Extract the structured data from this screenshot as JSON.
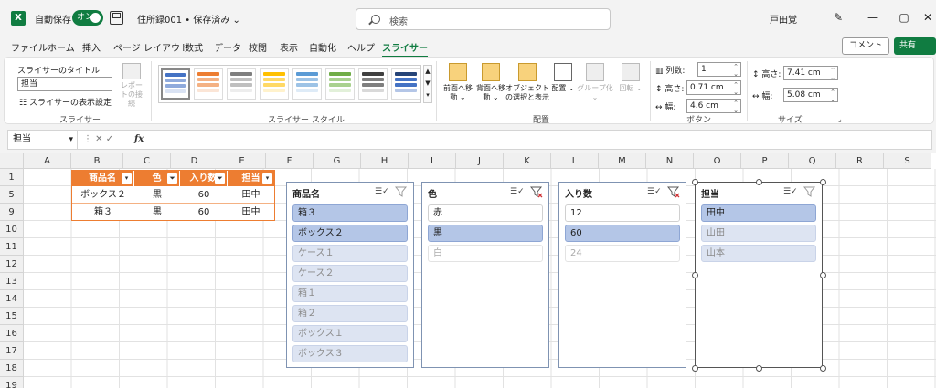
{
  "titlebar": {
    "logo": "X",
    "autosave_label": "自動保存",
    "autosave_state": "オン",
    "filename": "住所録001 • 保存済み ⌄",
    "search_placeholder": "検索",
    "username": "戸田覚",
    "minimize": "—",
    "maximize": "▢",
    "close": "✕"
  },
  "tabs": [
    "ファイル",
    "ホーム",
    "挿入",
    "ページ レイアウト",
    "数式",
    "データ",
    "校閲",
    "表示",
    "自動化",
    "ヘルプ",
    "スライサー"
  ],
  "active_tab": "スライサー",
  "comment_label": "コメント",
  "share_label": "共有",
  "ribbon": {
    "slicer_group": {
      "caption_label": "スライサーのタイトル:",
      "caption_value": "担当",
      "settings_label": "スライサーの表示設定",
      "report_label": "レポートの接続",
      "group_label": "スライサー"
    },
    "styles_group_label": "スライサー スタイル",
    "arrange": {
      "bring_forward": "前面へ移動 ⌄",
      "send_backward": "背面へ移動 ⌄",
      "selection_pane": "オブジェクトの選択と表示",
      "align": "配置 ⌄",
      "group": "グループ化 ⌄",
      "rotate": "回転 ⌄",
      "group_label": "配置"
    },
    "buttons": {
      "columns_label": "列数:",
      "columns_value": "1",
      "height_label": "高さ:",
      "height_value": "0.71 cm",
      "width_label": "幅:",
      "width_value": "4.6 cm",
      "group_label": "ボタン"
    },
    "size": {
      "height_label": "高さ:",
      "height_value": "7.41 cm",
      "width_label": "幅:",
      "width_value": "5.08 cm",
      "group_label": "サイズ"
    }
  },
  "formula_bar": {
    "namebox": "担当",
    "icons": "⋮  ✕  ✓",
    "fx": "fx",
    "content": ""
  },
  "columns": [
    "A",
    "B",
    "C",
    "D",
    "E",
    "F",
    "G",
    "H",
    "I",
    "J",
    "K",
    "L",
    "M",
    "N",
    "O",
    "P",
    "Q",
    "R",
    "S"
  ],
  "rows": [
    "1",
    "5",
    "9",
    "10",
    "11",
    "12",
    "13",
    "14",
    "15",
    "16",
    "17",
    "18",
    "19"
  ],
  "table": {
    "headers": [
      "商品名",
      "色",
      "入り数",
      "担当"
    ],
    "rows": [
      [
        "ボックス２",
        "黒",
        "60",
        "田中"
      ],
      [
        "箱３",
        "黒",
        "60",
        "田中"
      ]
    ]
  },
  "slicers": [
    {
      "title": "商品名",
      "items": [
        {
          "label": "箱３",
          "state": "sel"
        },
        {
          "label": "ボックス２",
          "state": "sel"
        },
        {
          "label": "ケース１",
          "state": "nodata-sel"
        },
        {
          "label": "ケース２",
          "state": "nodata-sel"
        },
        {
          "label": "箱１",
          "state": "nodata-sel"
        },
        {
          "label": "箱２",
          "state": "nodata-sel"
        },
        {
          "label": "ボックス１",
          "state": "nodata-sel"
        },
        {
          "label": "ボックス３",
          "state": "nodata-sel"
        }
      ]
    },
    {
      "title": "色",
      "items": [
        {
          "label": "赤",
          "state": "unsel"
        },
        {
          "label": "黒",
          "state": "sel"
        },
        {
          "label": "白",
          "state": "nodata"
        }
      ]
    },
    {
      "title": "入り数",
      "items": [
        {
          "label": "12",
          "state": "unsel"
        },
        {
          "label": "60",
          "state": "sel"
        },
        {
          "label": "24",
          "state": "nodata"
        }
      ]
    },
    {
      "title": "担当",
      "items": [
        {
          "label": "田中",
          "state": "sel"
        },
        {
          "label": "山田",
          "state": "nodata-sel"
        },
        {
          "label": "山本",
          "state": "nodata-sel"
        }
      ]
    }
  ],
  "multi_select_icon": "☰✓",
  "colors": {
    "accent": "#107c41",
    "table_header": "#ed7d31",
    "slicer_selected": "#b4c6e7"
  }
}
